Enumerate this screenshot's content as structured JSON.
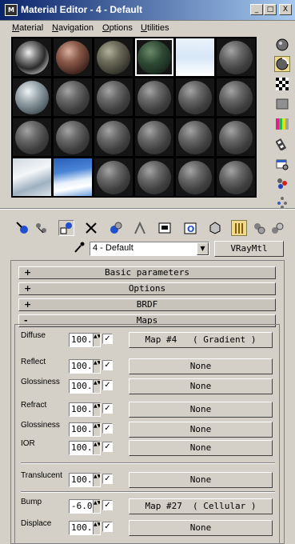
{
  "window": {
    "title": "Material Editor - 4 - Default",
    "controls": {
      "minimize": "_",
      "maximize": "□",
      "close": "X"
    }
  },
  "menu": [
    "Material",
    "Navigation",
    "Options",
    "Utilities"
  ],
  "slots": [
    "chrome",
    "brick",
    "stone",
    "green",
    "flat-sky",
    "default",
    "marble",
    "default",
    "default",
    "default",
    "default",
    "default",
    "default",
    "default",
    "default",
    "default",
    "default",
    "default",
    "flat-clouds",
    "flat-bluesky",
    "default",
    "default",
    "default",
    "default"
  ],
  "active_slot": 3,
  "right_toolbar": [
    "sample-type-icon",
    "backlight-icon",
    "background-checker-icon",
    "sample-uv-tiling-icon",
    "video-color-check-icon",
    "make-preview-icon",
    "options-icon",
    "select-by-material-icon",
    "material-map-navigator-icon"
  ],
  "material": {
    "name": "4 - Default",
    "type": "VRayMtl"
  },
  "rollouts": [
    {
      "sign": "+",
      "title": "Basic parameters"
    },
    {
      "sign": "+",
      "title": "Options"
    },
    {
      "sign": "+",
      "title": "BRDF"
    },
    {
      "sign": "-",
      "title": "Maps"
    }
  ],
  "maps": [
    {
      "label": "Diffuse",
      "amount": "100.0",
      "checked": "✓",
      "map": "Map #4   ( Gradient )"
    },
    {
      "label": "Reflect",
      "amount": "100.0",
      "checked": "✓",
      "map": "None"
    },
    {
      "label": "Glossiness",
      "amount": "100.0",
      "checked": "✓",
      "map": "None"
    },
    {
      "label": "Refract",
      "amount": "100.0",
      "checked": "✓",
      "map": "None"
    },
    {
      "label": "Glossiness",
      "amount": "100.0",
      "checked": "✓",
      "map": "None"
    },
    {
      "label": "IOR",
      "amount": "100.0",
      "checked": "✓",
      "map": "None"
    },
    {
      "label": "Translucent",
      "amount": "100.0",
      "checked": "✓",
      "map": "None"
    },
    {
      "label": "Bump",
      "amount": "-6.0",
      "checked": "✓",
      "map": "Map #27  ( Cellular )"
    },
    {
      "label": "Displace",
      "amount": "100.0",
      "checked": "✓",
      "map": "None"
    }
  ]
}
